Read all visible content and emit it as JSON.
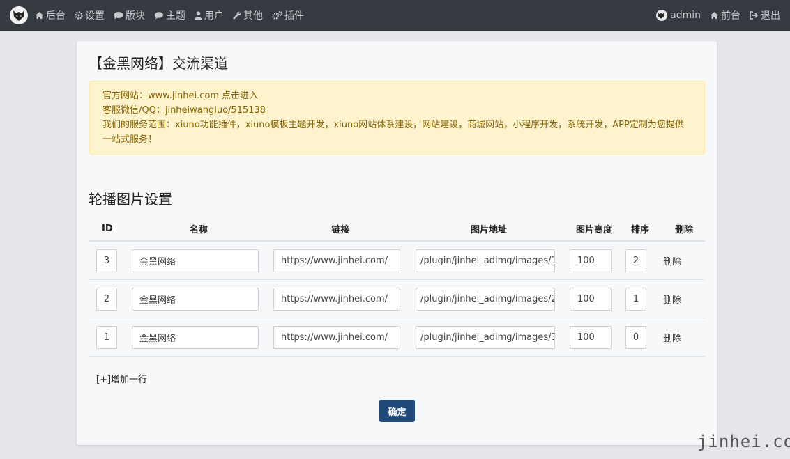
{
  "nav": {
    "left": [
      {
        "icon": "home-icon",
        "label": "后台"
      },
      {
        "icon": "gear-icon",
        "label": "设置"
      },
      {
        "icon": "comment-icon",
        "label": "版块"
      },
      {
        "icon": "comments-icon",
        "label": "主题"
      },
      {
        "icon": "user-icon",
        "label": "用户"
      },
      {
        "icon": "wrench-icon",
        "label": "其他"
      },
      {
        "icon": "cogs-icon",
        "label": "插件"
      }
    ],
    "right": [
      {
        "icon": "avatar",
        "label": "admin"
      },
      {
        "icon": "home-icon",
        "label": "前台"
      },
      {
        "icon": "sign-out-icon",
        "label": "退出"
      }
    ]
  },
  "card": {
    "title": "【金黑网络】交流渠道",
    "notice": {
      "line1": "官方网站：www.jinhei.com 点击进入",
      "line2": "客服微信/QQ：jinheiwangluo/515138",
      "line3": "我们的服务范围：xiuno功能插件，xiuno模板主题开发，xiuno网站体系建设，网站建设，商城网站，小程序开发，系统开发，APP定制为您提供一站式服务！"
    },
    "section_title": "轮播图片设置",
    "table": {
      "headers": {
        "id": "ID",
        "name": "名称",
        "link": "链接",
        "image": "图片地址",
        "height": "图片高度",
        "sort": "排序",
        "delete": "删除"
      },
      "rows": [
        {
          "id": "3",
          "name": "金黑网络",
          "link": "https://www.jinhei.com/",
          "image": "/plugin/jinhei_adimg/images/1",
          "height": "100",
          "sort": "2",
          "delete": "删除"
        },
        {
          "id": "2",
          "name": "金黑网络",
          "link": "https://www.jinhei.com/",
          "image": "/plugin/jinhei_adimg/images/2",
          "height": "100",
          "sort": "1",
          "delete": "删除"
        },
        {
          "id": "1",
          "name": "金黑网络",
          "link": "https://www.jinhei.com/",
          "image": "/plugin/jinhei_adimg/images/3",
          "height": "100",
          "sort": "0",
          "delete": "删除"
        }
      ]
    },
    "add_row": "[+]增加一行",
    "submit": "确定"
  },
  "watermark": "jinhei.com",
  "colors": {
    "navbar": "#343a40",
    "notice_bg": "#fff3cd",
    "notice_text": "#856404",
    "primary": "#1f4a7a"
  }
}
